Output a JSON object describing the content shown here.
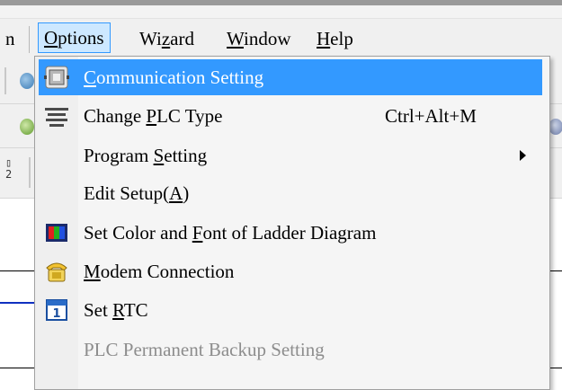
{
  "menubar": {
    "partial_left_label": "n",
    "items": [
      {
        "label": "Options",
        "u": "O",
        "rest": "ptions"
      },
      {
        "label": "Wizard",
        "pre": "Wi",
        "u": "z",
        "rest": "ard"
      },
      {
        "label": "Window",
        "u": "W",
        "rest": "indow"
      },
      {
        "label": "Help",
        "u": "H",
        "rest": "elp"
      }
    ]
  },
  "options_menu": {
    "items": [
      {
        "pre": "",
        "u": "C",
        "rest": "ommunication Setting",
        "icon": "communication-icon",
        "state": "highlighted"
      },
      {
        "pre": "Change ",
        "u": "P",
        "rest": "LC Type",
        "shortcut": "Ctrl+Alt+M",
        "icon": "plc-type-icon"
      },
      {
        "pre": "Program ",
        "u": "S",
        "rest": "etting",
        "submenu": true
      },
      {
        "pre": "Edit Setup(",
        "u": "A",
        "rest": ")"
      },
      {
        "pre": "Set Color and ",
        "u": "F",
        "rest": "ont of Ladder Diagram",
        "icon": "color-bars-icon"
      },
      {
        "pre": "",
        "u": "M",
        "rest": "odem Connection",
        "icon": "modem-icon"
      },
      {
        "pre": "Set ",
        "u": "R",
        "rest": "TC",
        "icon": "calendar-icon"
      },
      {
        "pre": "PLC Permanent Backup Setting",
        "u": "",
        "rest": "",
        "state": "disabled"
      }
    ]
  },
  "toolbar": {
    "stacked_icon_text": "▯\n2"
  },
  "colors": {
    "highlight": "#3399ff",
    "menu_bg": "#f5f5f5",
    "disabled_text": "#8d8d8d"
  }
}
